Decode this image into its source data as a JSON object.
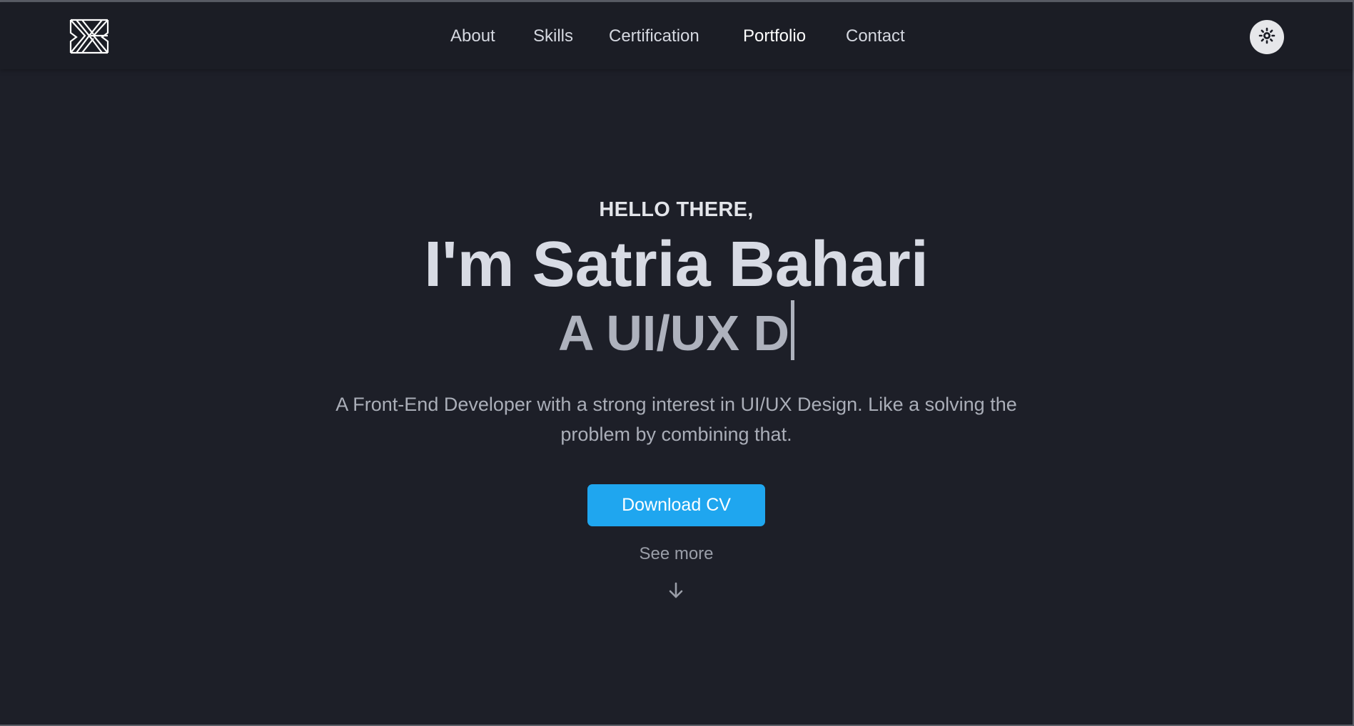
{
  "nav": {
    "logo_icon": "x-monogram-logo",
    "links": [
      {
        "label": "About"
      },
      {
        "label": "Skills"
      },
      {
        "label": "Certification"
      },
      {
        "label": "Portfolio",
        "active": true
      },
      {
        "label": "Contact"
      }
    ],
    "theme_toggle_icon": "sun-icon"
  },
  "hero": {
    "greeting": "HELLO THERE,",
    "name": "I'm Satria Bahari",
    "role_typed": "A UI/UX D",
    "description": "A Front-End Developer with a strong interest in UI/UX Design. Like a solving the problem by combining that.",
    "download_label": "Download CV",
    "see_more_label": "See more",
    "arrow_icon": "arrow-down-icon"
  },
  "colors": {
    "background": "#1d1f28",
    "accent": "#1fa6ef"
  }
}
